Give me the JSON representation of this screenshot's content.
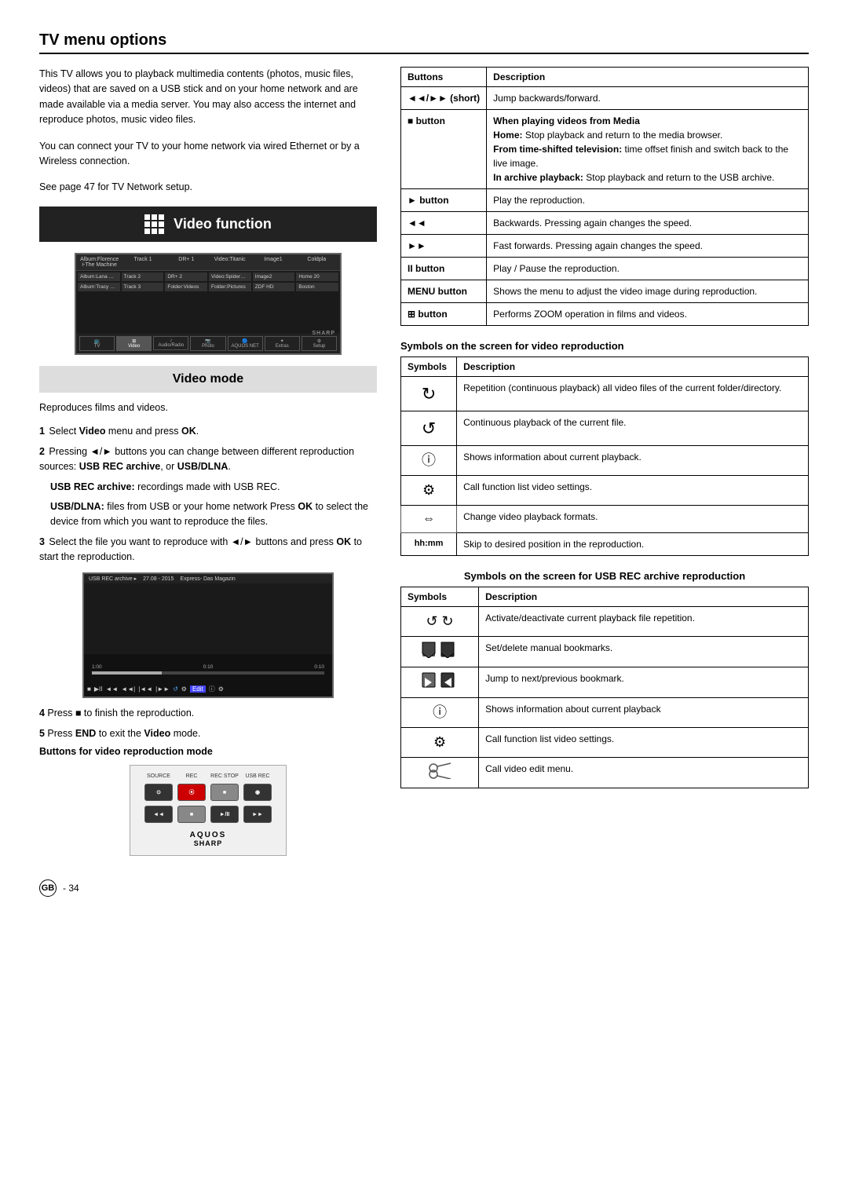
{
  "page": {
    "title": "TV menu options",
    "footer": "GB - 34"
  },
  "left": {
    "intro": [
      "This TV allows you to playback multimedia contents (photos, music files, videos) that are saved on a USB stick and on your home network and are made available via a media server.  You may also access the internet and reproduce photos, music video files.",
      "You can connect your TV to your home network via wired Ethernet or by a Wireless connection.",
      "See page 47 for TV Network setup."
    ],
    "video_function_label": "Video function",
    "video_mode_label": "Video mode",
    "reproduces_text": "Reproduces films and videos.",
    "steps": [
      {
        "num": "1",
        "text": "Select Video menu and press OK."
      },
      {
        "num": "2",
        "text": "Pressing ◄/► buttons you can change between different reproduction sources: USB REC archive, or USB/DLNA.",
        "sub": [
          "USB REC archive: recordings made with USB REC.",
          "USB/DLNA: files from USB or your home network Press OK to select the device from which you want to reproduce the files."
        ]
      },
      {
        "num": "3",
        "text": "Select the file you want to reproduce with ◄/► buttons and press OK to start the reproduction."
      },
      {
        "num": "4",
        "text": "Press ■ to finish the reproduction."
      },
      {
        "num": "5",
        "text": "Press END to exit the Video mode."
      }
    ],
    "buttons_label": "Buttons for video reproduction mode",
    "remote_labels_row1": [
      "SOURCE",
      "REC",
      "REC STOP",
      "USB REC"
    ],
    "remote_labels_row2": [
      "◄◄",
      "■",
      "►/II",
      "►►"
    ],
    "aquos": "AQUOS",
    "sharp": "SHARP"
  },
  "right": {
    "main_table": {
      "col1_header": "Buttons",
      "col2_header": "Description",
      "rows": [
        {
          "button": "◄◄/►► (short)",
          "description": "Jump backwards/forward.",
          "bold_desc": false
        },
        {
          "button": "■ button",
          "description_bold": "When playing videos from Media",
          "description_parts": [
            {
              "bold": false,
              "text": "Home: Stop playback and return to the media browser."
            },
            {
              "bold": true,
              "text": "From time-shifted television:"
            },
            {
              "bold": false,
              "text": " time offset finish and switch back to the live image."
            },
            {
              "bold": true,
              "text": "In archive playback:"
            },
            {
              "bold": false,
              "text": " Stop playback and return to the USB archive."
            }
          ]
        },
        {
          "button": "► button",
          "description": "Play the reproduction."
        },
        {
          "button": "◄◄",
          "description": "Backwards. Pressing again changes the speed."
        },
        {
          "button": "►►",
          "description": "Fast forwards. Pressing again changes the speed."
        },
        {
          "button": "II button",
          "description": "Play / Pause the reproduction."
        },
        {
          "button": "MENU button",
          "description": "Shows the menu to adjust the video image during reproduction."
        },
        {
          "button": "⊞ button",
          "description": "Performs ZOOM operation in films and videos."
        }
      ]
    },
    "symbols_section1": {
      "title": "Symbols on the screen for video reproduction",
      "col1_header": "Symbols",
      "col2_header": "Description",
      "rows": [
        {
          "symbol": "↻",
          "description": "Repetition (continuous playback) all video files of the current folder/directory."
        },
        {
          "symbol": "↺",
          "description": "Continuous playback of the current file."
        },
        {
          "symbol": "ⓘ",
          "description": "Shows information about current playback."
        },
        {
          "symbol": "⚙",
          "description": "Call function list video settings."
        },
        {
          "symbol": "⇔",
          "description": "Change video playback formats."
        },
        {
          "symbol": "hh:mm",
          "description": "Skip to desired position in the reproduction."
        }
      ]
    },
    "symbols_section2": {
      "title": "Symbols on the screen for USB REC archive reproduction",
      "col1_header": "Symbols",
      "col2_header": "Description",
      "rows": [
        {
          "symbol": "↺ ↻",
          "description": "Activate/deactivate current playback file repetition."
        },
        {
          "symbol": "🔖 🔖",
          "description": "Set/delete manual bookmarks."
        },
        {
          "symbol": "⏭ ⏮",
          "description": "Jump to next/previous bookmark."
        },
        {
          "symbol": "ⓘ",
          "description": "Shows information about current playback"
        },
        {
          "symbol": "⚙",
          "description": "Call function list video settings."
        },
        {
          "symbol": "✂",
          "description": "Call video edit menu."
        }
      ]
    }
  }
}
